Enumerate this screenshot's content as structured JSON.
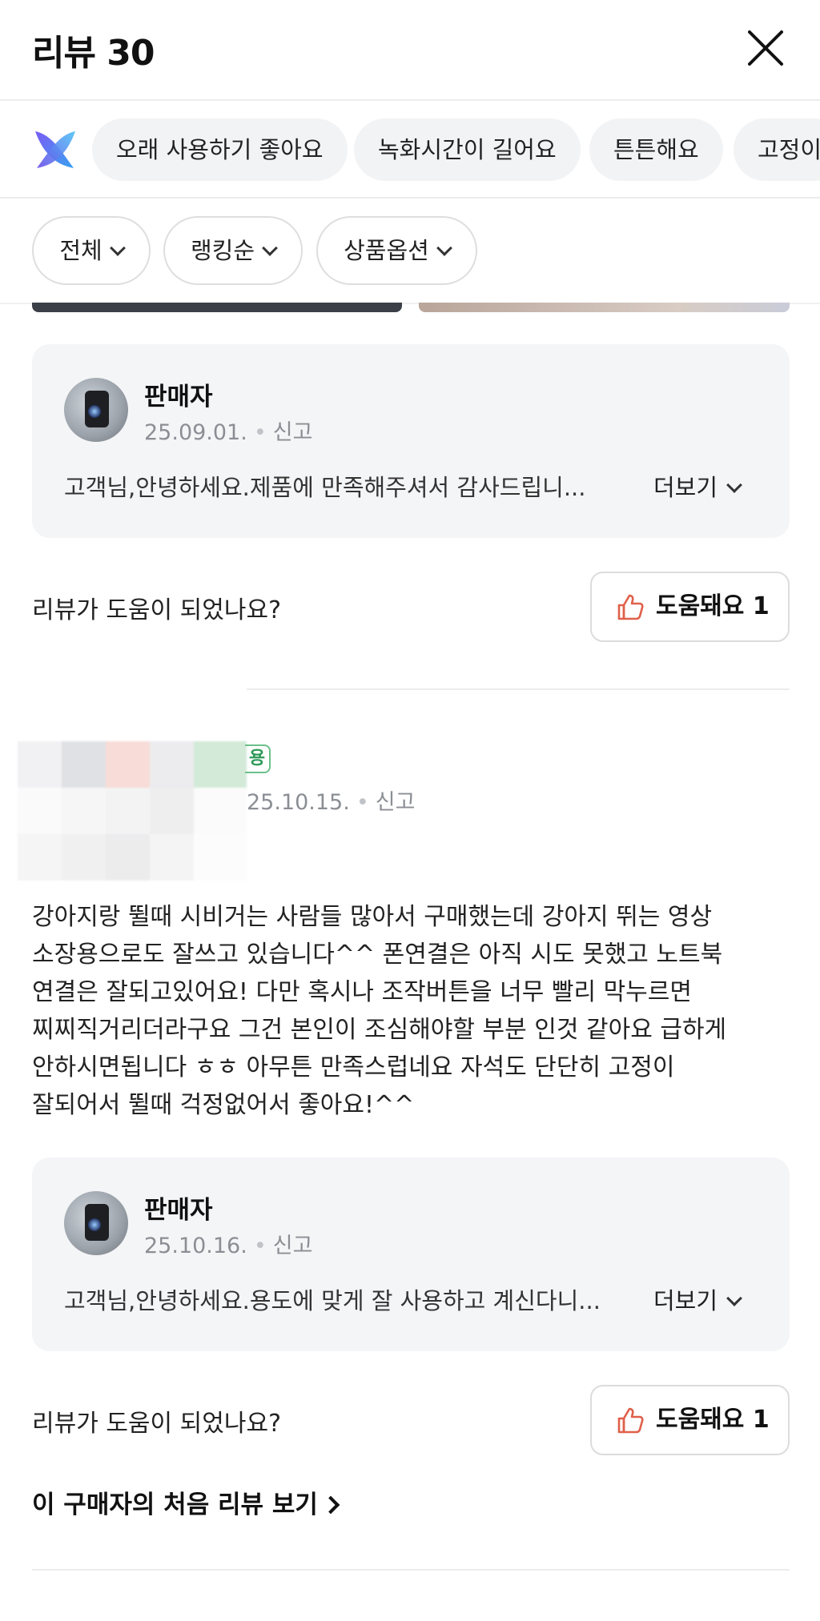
{
  "header": {
    "title": "리뷰 30"
  },
  "keywords": [
    "오래 사용하기 좋아요",
    "녹화시간이 길어요",
    "튼튼해요",
    "고정이"
  ],
  "filters": [
    "전체",
    "랭킹순",
    "상품옵션"
  ],
  "reply1": {
    "name": "판매자",
    "date": "25.09.01.",
    "report": "신고",
    "text": "고객님,안녕하세요.제품에 만족해주셔서 감사드립니...",
    "more": "더보기"
  },
  "helpful1": {
    "question": "리뷰가 도움이 되었나요?",
    "button": "도움돼요 1"
  },
  "review2": {
    "badge": "용",
    "date": "25.10.15.",
    "report": "신고",
    "lines": [
      "강아지랑  뛸때  시비거는  사람들 많아서  구매했는데  강아지 뛰는 영상",
      "소장용으로도  잘쓰고 있습니다^^ 폰연결은  아직  시도  못했고  노트북",
      "연결은  잘되고있어요! 다만 혹시나  조작버튼을  너무 빨리  막누르면",
      "찌찌직거리더라구요 그건  본인이  조심해야할  부분 인것 같아요 급하게",
      "안하시면됩니다 ㅎㅎ   아무튼  만족스럽네요  자석도 단단히  고정이",
      "잘되어서  뛸때  걱정없어서  좋아요!^^"
    ]
  },
  "reply2": {
    "name": "판매자",
    "date": "25.10.16.",
    "report": "신고",
    "text": "고객님,안녕하세요.용도에 맞게 잘 사용하고 계신다니...",
    "more": "더보기"
  },
  "helpful2": {
    "question": "리뷰가 도움이 되었나요?",
    "button": "도움돼요 1"
  },
  "first_review_link": "이 구매자의 처음 리뷰 보기",
  "icons": {
    "close": "close-icon",
    "logo": "ai-logo-icon",
    "thumb": "thumbs-up-icon",
    "chevron": "chevron-down-icon"
  },
  "colors": {
    "thumb": "#e0604a",
    "badge": "#2e9a58",
    "chip_bg": "#f2f3f5",
    "reply_bg": "#f4f5f7"
  }
}
